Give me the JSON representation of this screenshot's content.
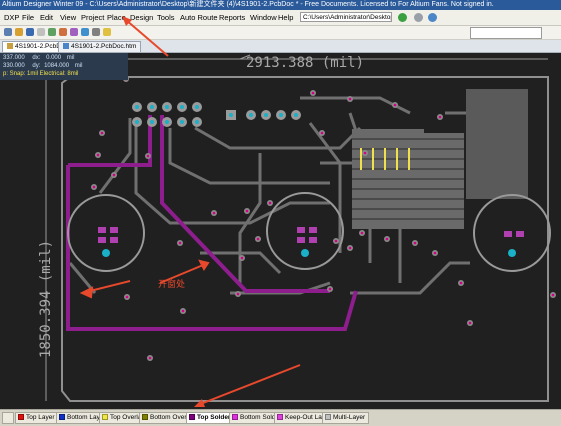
{
  "window": {
    "title": "Altium Designer Winter 09 - C:\\Users\\Administrator\\Desktop\\新建文件夹 (4)\\4S1901-2.PcbDoc * - Free Documents. Licensed to For Altium Fans. Not signed in."
  },
  "menu": {
    "items": [
      "DXP",
      "File",
      "Edit",
      "View",
      "Project",
      "Place",
      "Design",
      "Tools",
      "Auto Route",
      "Reports",
      "Window",
      "Help"
    ],
    "path": "C:\\Users\\Administrator\\Desktop\\"
  },
  "doc_tabs": [
    "4S1901-2.PcbDoc *",
    "4S1901-2.PcbDoc.htm"
  ],
  "coords": {
    "x": "337.000",
    "dx_label": "dx:",
    "dx": "0.000",
    "y": "330.000",
    "dy_label": "dy:",
    "dy": "1084.000",
    "unit": "mil",
    "status": "p: Snap: 1mil Electrical: 8mil"
  },
  "dimensions": {
    "width": "2913.388 (mil)",
    "height": "1850.394 (mil)"
  },
  "annotation": {
    "text": "开窗处",
    "color": "#e8492c"
  },
  "layers": [
    {
      "name": "Top Layer",
      "color": "#e01010",
      "active": false
    },
    {
      "name": "Bottom Layer",
      "color": "#1030c8",
      "active": false
    },
    {
      "name": "Top Overlay",
      "color": "#f0e840",
      "active": false
    },
    {
      "name": "Bottom Overlay",
      "color": "#808000",
      "active": false
    },
    {
      "name": "Top Solder",
      "color": "#800080",
      "active": true
    },
    {
      "name": "Bottom Solder",
      "color": "#e030e0",
      "active": false
    },
    {
      "name": "Keep-Out Layer",
      "color": "#e040e0",
      "active": false
    },
    {
      "name": "Multi-Layer",
      "color": "#c0c0c0",
      "active": false
    }
  ],
  "colors": {
    "board_bg": "#202020",
    "solder_mask": "#8e1d8e",
    "outline": "#909090",
    "pad": "#8a8a8a",
    "via_hole": "#d60088"
  }
}
